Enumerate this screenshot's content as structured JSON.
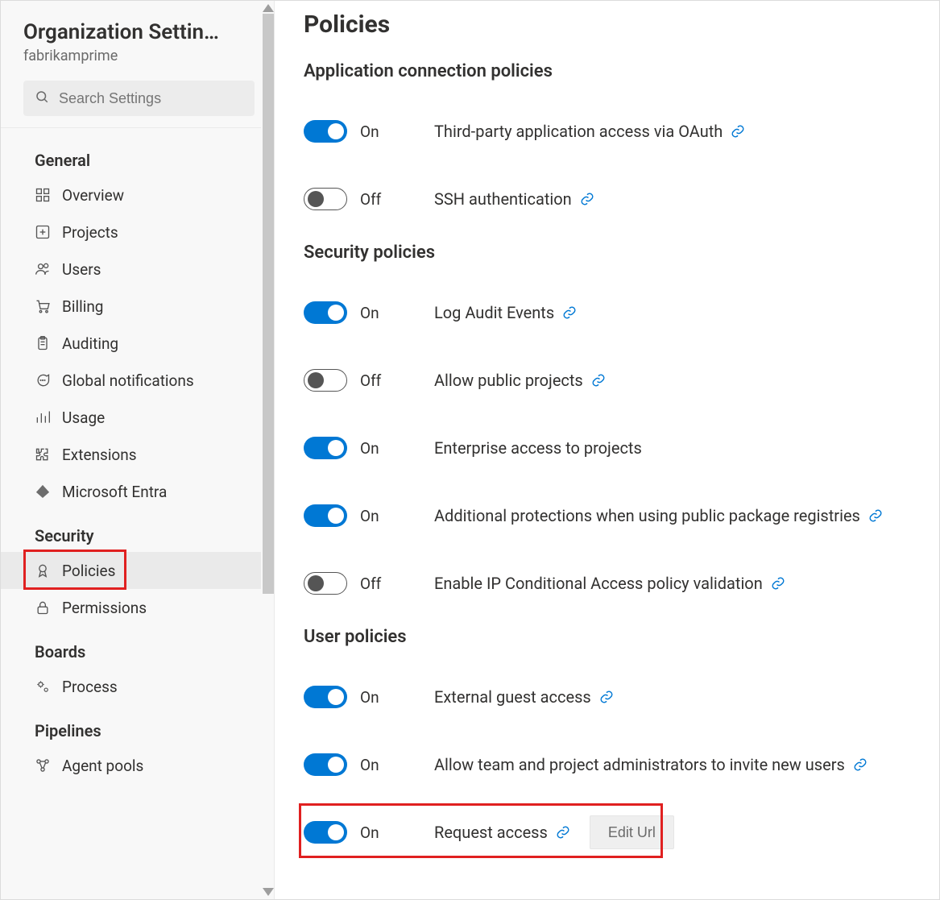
{
  "sidebar": {
    "title": "Organization Settin…",
    "subtitle": "fabrikamprime",
    "searchPlaceholder": "Search Settings",
    "groups": [
      {
        "label": "General",
        "items": [
          {
            "id": "overview",
            "label": "Overview",
            "icon": "grid-icon"
          },
          {
            "id": "projects",
            "label": "Projects",
            "icon": "plus-square-icon"
          },
          {
            "id": "users",
            "label": "Users",
            "icon": "users-icon"
          },
          {
            "id": "billing",
            "label": "Billing",
            "icon": "cart-icon"
          },
          {
            "id": "auditing",
            "label": "Auditing",
            "icon": "clipboard-icon"
          },
          {
            "id": "global-notifications",
            "label": "Global notifications",
            "icon": "chat-icon"
          },
          {
            "id": "usage",
            "label": "Usage",
            "icon": "bar-chart-icon"
          },
          {
            "id": "extensions",
            "label": "Extensions",
            "icon": "puzzle-icon"
          },
          {
            "id": "microsoft-entra",
            "label": "Microsoft Entra",
            "icon": "entra-icon"
          }
        ]
      },
      {
        "label": "Security",
        "items": [
          {
            "id": "policies",
            "label": "Policies",
            "icon": "ribbon-icon",
            "active": true,
            "highlighted": true
          },
          {
            "id": "permissions",
            "label": "Permissions",
            "icon": "lock-icon"
          }
        ]
      },
      {
        "label": "Boards",
        "items": [
          {
            "id": "process",
            "label": "Process",
            "icon": "gears-icon"
          }
        ]
      },
      {
        "label": "Pipelines",
        "items": [
          {
            "id": "agent-pools",
            "label": "Agent pools",
            "icon": "network-icon"
          }
        ]
      }
    ]
  },
  "main": {
    "pageTitle": "Policies",
    "onLabel": "On",
    "offLabel": "Off",
    "editUrlLabel": "Edit Url",
    "sections": [
      {
        "title": "Application connection policies",
        "policies": [
          {
            "id": "oauth",
            "state": "on",
            "label": "Third-party application access via OAuth",
            "hasLink": true
          },
          {
            "id": "ssh",
            "state": "off",
            "label": "SSH authentication",
            "hasLink": true
          }
        ]
      },
      {
        "title": "Security policies",
        "policies": [
          {
            "id": "audit",
            "state": "on",
            "label": "Log Audit Events",
            "hasLink": true
          },
          {
            "id": "pubproj",
            "state": "off",
            "label": "Allow public projects",
            "hasLink": true
          },
          {
            "id": "entaccess",
            "state": "on",
            "label": "Enterprise access to projects",
            "hasLink": false
          },
          {
            "id": "pkgreg",
            "state": "on",
            "label": "Additional protections when using public package registries",
            "hasLink": true
          },
          {
            "id": "ipcond",
            "state": "off",
            "label": "Enable IP Conditional Access policy validation",
            "hasLink": true
          }
        ]
      },
      {
        "title": "User policies",
        "policies": [
          {
            "id": "guest",
            "state": "on",
            "label": "External guest access",
            "hasLink": true
          },
          {
            "id": "invite",
            "state": "on",
            "label": "Allow team and project administrators to invite new users",
            "hasLink": true
          },
          {
            "id": "reqaccess",
            "state": "on",
            "label": "Request access",
            "hasLink": true,
            "editUrl": true,
            "highlighted": true
          }
        ]
      }
    ]
  }
}
